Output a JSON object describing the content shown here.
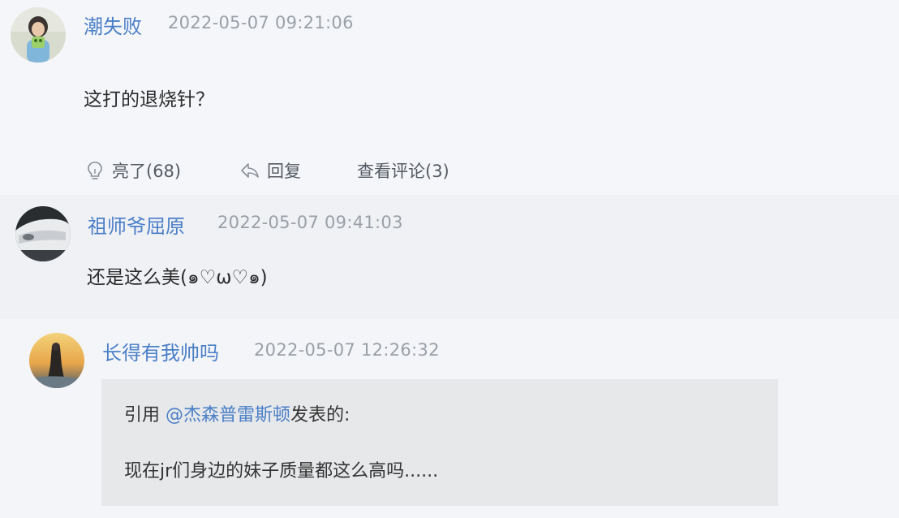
{
  "comments": [
    {
      "username": "潮失败",
      "time": "2022-05-07 09:21:06",
      "text": "这打的退烧针？",
      "actions": {
        "like_label": "亮了(68)",
        "reply_label": "回复",
        "view_replies_label": "查看评论(3)"
      }
    },
    {
      "username": "祖师爷屈原",
      "time": "2022-05-07 09:41:03",
      "text": "还是这么美(๑♡ω♡๑)"
    },
    {
      "username": "长得有我帅吗",
      "time": "2022-05-07 12:26:32",
      "quote": {
        "prefix": "引用 ",
        "mention": "@杰森普雷斯顿",
        "suffix": "发表的:",
        "text": "现在jr们身边的妹子质量都这么高吗......"
      }
    }
  ],
  "icons": {
    "like": "lightbulb-icon",
    "reply": "reply-arrow-icon"
  },
  "colors": {
    "username": "#4a7fc7",
    "timestamp": "#9aa0a8",
    "quote_bg": "#e7e8ea"
  }
}
